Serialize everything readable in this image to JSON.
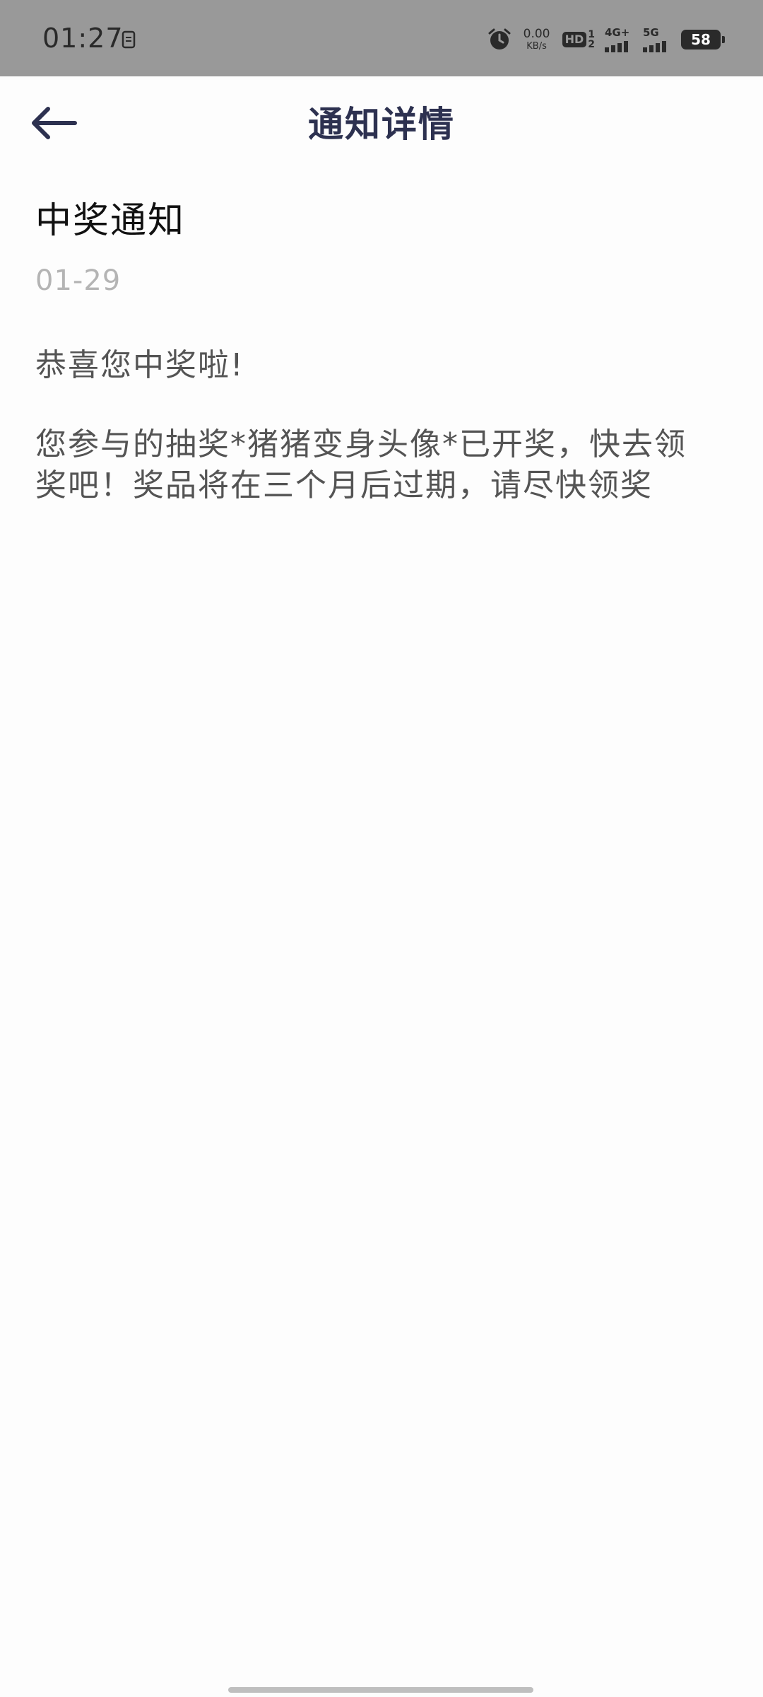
{
  "status_bar": {
    "time": "01:27",
    "net_speed_value": "0.00",
    "net_speed_unit": "KB/s",
    "hd_label": "HD",
    "hd_sim_top": "1",
    "hd_sim_bottom": "2",
    "signal1_label": "4G+",
    "signal2_label": "5G",
    "battery": "58",
    "icons": [
      "clipboard-icon",
      "alarm-icon",
      "signal-icon",
      "battery-icon"
    ]
  },
  "header": {
    "title": "通知详情",
    "back_icon": "arrow-left-icon"
  },
  "notice": {
    "title": "中奖通知",
    "date": "01-29",
    "greeting": "恭喜您中奖啦!",
    "body": "您参与的抽奖*猪猪变身头像*已开奖，快去领奖吧！奖品将在三个月后过期，请尽快领奖"
  },
  "colors": {
    "status_bar_bg": "#999999",
    "title_color": "#2d3150",
    "date_color": "#b4b4b4",
    "body_color": "#545454"
  }
}
